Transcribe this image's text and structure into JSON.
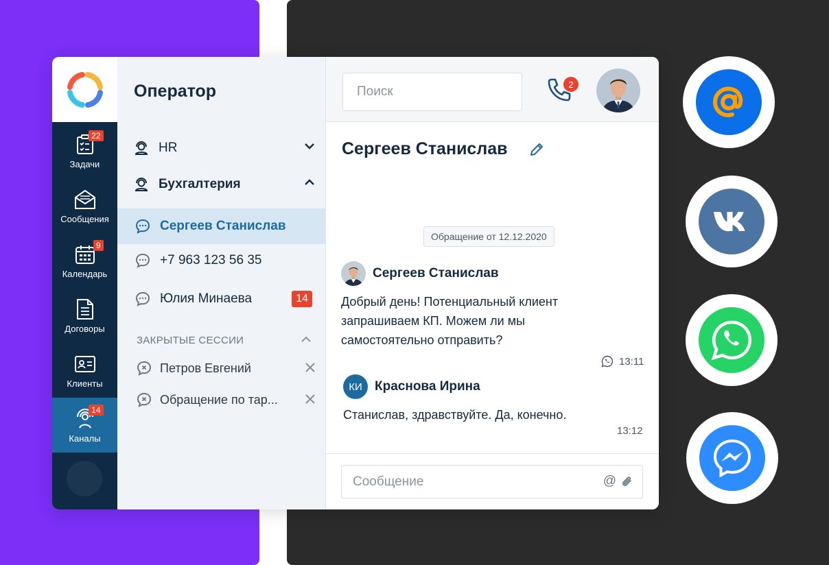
{
  "operator_panel": {
    "title": "Оператор",
    "departments": [
      {
        "label": "HR",
        "expanded": false
      },
      {
        "label": "Бухгалтерия",
        "expanded": true
      }
    ],
    "chats": [
      {
        "label": "Сергеев Станислав",
        "active": true
      },
      {
        "label": "+7 963 123 56 35",
        "active": false
      },
      {
        "label": "Юлия Минаева",
        "active": false,
        "badge": "14"
      }
    ],
    "closed_sessions_label": "ЗАКРЫТЫЕ СЕССИИ",
    "closed_sessions": [
      {
        "label": "Петров Евгений"
      },
      {
        "label": "Обращение по тар..."
      }
    ]
  },
  "rail": {
    "items": [
      {
        "label": "Задачи",
        "badge": "22",
        "icon": "tasks-icon"
      },
      {
        "label": "Сообщения",
        "badge": "",
        "icon": "messages-icon"
      },
      {
        "label": "Календарь",
        "badge": "9",
        "icon": "calendar-icon"
      },
      {
        "label": "Договоры",
        "badge": "",
        "icon": "document-icon"
      },
      {
        "label": "Клиенты",
        "badge": "",
        "icon": "client-card-icon"
      },
      {
        "label": "Каналы",
        "badge": "14",
        "icon": "channels-icon",
        "active": true
      }
    ]
  },
  "topbar": {
    "search_placeholder": "Поиск",
    "call_badge": "2"
  },
  "conversation": {
    "title": "Сергеев Станислав",
    "date_chip": "Обращение от 12.12.2020",
    "messages": [
      {
        "author": "Сергеев Станислав",
        "text_lines": [
          "Добрый день! Потенциальный клиент",
          "запрашиваем КП. Можем ли мы",
          "самостоятельно отправить?"
        ],
        "time": "13:11",
        "channel_icon": "whatsapp-icon"
      },
      {
        "author": "Краснова Ирина",
        "initials": "КИ",
        "text_lines": [
          "Станислав, здравствуйте. Да, конечно."
        ],
        "time": "13:12"
      }
    ],
    "composer_placeholder": "Сообщение",
    "composer_at": "@"
  },
  "channels": [
    {
      "name": "mail-ru",
      "color": "#0a6fe8",
      "icon": "at-sign-icon"
    },
    {
      "name": "vk",
      "color": "#4c75a3",
      "icon": "vk-icon"
    },
    {
      "name": "whatsapp",
      "color": "#25d366",
      "icon": "whatsapp-icon"
    },
    {
      "name": "messenger",
      "color": "#2d8cff",
      "icon": "messenger-icon"
    }
  ],
  "colors": {
    "brand_purple": "#7b2ff7",
    "rail_bg": "#0f2a44",
    "accent": "#1d6b9e",
    "badge_red": "#e8432f"
  }
}
